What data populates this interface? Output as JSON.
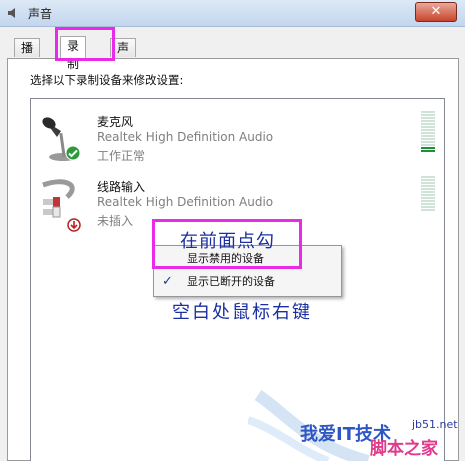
{
  "window": {
    "title": "声音",
    "close_label": "✕"
  },
  "tabs": [
    {
      "label": "播放",
      "active": false
    },
    {
      "label": "录制",
      "active": true
    },
    {
      "label": "声音",
      "active": false
    }
  ],
  "instruction": "选择以下录制设备来修改设置:",
  "devices": [
    {
      "name": "麦克风",
      "description": "Realtek High Definition Audio",
      "status": "工作正常",
      "icon": "microphone-icon",
      "badge": "green-check-badge",
      "level_active_bars": 2,
      "level_total_bars": 14
    },
    {
      "name": "线路输入",
      "description": "Realtek High Definition Audio",
      "status": "未插入",
      "icon": "line-in-cable-icon",
      "badge": "red-down-arrow-badge",
      "level_active_bars": 0,
      "level_total_bars": 12
    }
  ],
  "context_menu": {
    "items": [
      {
        "label": "显示禁用的设备",
        "checked": false
      },
      {
        "label": "显示已断开的设备",
        "checked": true
      }
    ],
    "check_glyph": "✓"
  },
  "annotations": {
    "top": "在前面点勾",
    "bottom": "空白处鼠标右键"
  },
  "watermark": {
    "site": "jb51.net",
    "text_left": "我爱IT技术",
    "text_right": "脚本之家"
  },
  "colors": {
    "highlight": "#e82be8",
    "annotation": "#1b2fa0",
    "meter_on": "#1f8f3a"
  }
}
